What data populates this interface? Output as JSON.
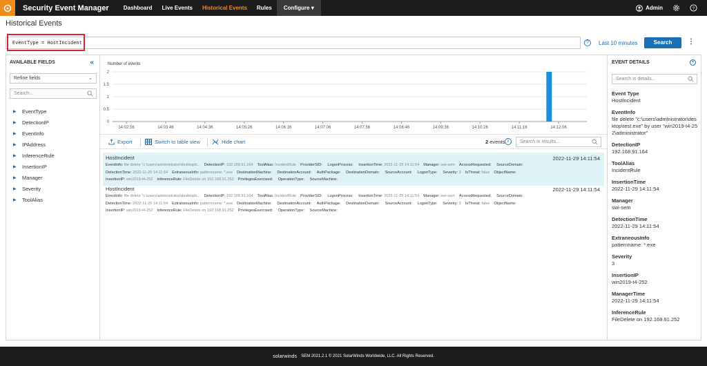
{
  "app": {
    "title": "Security Event Manager",
    "nav": [
      "Dashboard",
      "Live Events",
      "Historical Events",
      "Rules"
    ],
    "configure": "Configure ▾",
    "user": "Admin"
  },
  "page": {
    "title": "Historical Events",
    "query": "EventType = HostIncident",
    "time_range": "Last 10 minutes",
    "search_button": "Search"
  },
  "left_panel": {
    "header": "AVAILABLE FIELDS",
    "refine": "Refine fields",
    "search_placeholder": "Search...",
    "fields": [
      "EventType",
      "DetectionIP",
      "EventInfo",
      "IPAddress",
      "InferenceRule",
      "InsertionIP",
      "Manager",
      "Severity",
      "ToolAlias"
    ]
  },
  "chart_data": {
    "type": "bar",
    "ylabel": "Number of events",
    "ylim": [
      0,
      2
    ],
    "yticks": [
      "0",
      "0.5",
      "1",
      "1.5",
      "2"
    ],
    "x_ticks": [
      "14:02:56",
      "14:03:46",
      "14:04:36",
      "14:05:26",
      "14:06:16",
      "14:07:06",
      "14:07:56",
      "14:08:46",
      "14:09:36",
      "14:10:26",
      "14:11:16",
      "14:12:06"
    ],
    "bars": [
      {
        "x": "14:11:54",
        "value": 2
      }
    ],
    "bar_color": "#1a8fe0"
  },
  "toolbar": {
    "export": "Export",
    "table_view": "Switch to table view",
    "hide_chart": "Hide chart",
    "count_num": "2",
    "count_label": "events",
    "results_placeholder": "Search in results..."
  },
  "events": [
    {
      "title": "HostIncident",
      "time": "2022-11-29 14:11:54",
      "line1": [
        [
          "EventInfo:",
          "file delete \"c:\\users\\administrator\\desktop\\t..."
        ],
        [
          "DetectionIP:",
          "192.168.91.164"
        ],
        [
          "ToolAlias:",
          "IncidentRule"
        ],
        [
          "ProviderSID:",
          ""
        ],
        [
          "LogonProcess:",
          ""
        ],
        [
          "InsertionTime:",
          "2022-11-29 14:11:54"
        ],
        [
          "Manager:",
          "swi-sem"
        ],
        [
          "AccessRequested:",
          ""
        ],
        [
          "SourceDomain:",
          ""
        ]
      ],
      "line2": [
        [
          "DetectionTime:",
          "2022-11-29 14:11:54"
        ],
        [
          "ExtraneousInfo:",
          "patternname: *.exe"
        ],
        [
          "DestinationMachine:",
          ""
        ],
        [
          "DestinationAccount:",
          ""
        ],
        [
          "AuthPackage:",
          ""
        ],
        [
          "DestinationDomain:",
          ""
        ],
        [
          "SourceAccount:",
          ""
        ],
        [
          "LogonType:",
          ""
        ],
        [
          "Severity:",
          "3"
        ],
        [
          "IsThreat:",
          "false"
        ],
        [
          "ObjectName:",
          ""
        ]
      ],
      "line3": [
        [
          "InsertionIP:",
          "win2019-t4-252"
        ],
        [
          "InferenceRule:",
          "FileDelete on 192.168.91.252"
        ],
        [
          "PrivilegesExercised:",
          ""
        ],
        [
          "OperationType:",
          ""
        ],
        [
          "SourceMachine:",
          ""
        ]
      ]
    },
    {
      "title": "HostIncident",
      "time": "2022-11-29 14:11:54",
      "line1": [
        [
          "EventInfo:",
          "file delete \"c:\\users\\administrator\\desktop\\t..."
        ],
        [
          "DetectionIP:",
          "192.168.91.164"
        ],
        [
          "ToolAlias:",
          "IncidentRule"
        ],
        [
          "ProviderSID:",
          ""
        ],
        [
          "LogonProcess:",
          ""
        ],
        [
          "InsertionTime:",
          "2022-11-29 14:11:54"
        ],
        [
          "Manager:",
          "swi-sem"
        ],
        [
          "AccessRequested:",
          ""
        ],
        [
          "SourceDomain:",
          ""
        ]
      ],
      "line2": [
        [
          "DetectionTime:",
          "2022-11-29 14:11:54"
        ],
        [
          "ExtraneousInfo:",
          "patternname: *.exe"
        ],
        [
          "DestinationMachine:",
          ""
        ],
        [
          "DestinationAccount:",
          ""
        ],
        [
          "AuthPackage:",
          ""
        ],
        [
          "DestinationDomain:",
          ""
        ],
        [
          "SourceAccount:",
          ""
        ],
        [
          "LogonType:",
          ""
        ],
        [
          "Severity:",
          "3"
        ],
        [
          "IsThreat:",
          "false"
        ],
        [
          "ObjectName:",
          ""
        ]
      ],
      "line3": [
        [
          "InsertionIP:",
          "win2019-t4-252"
        ],
        [
          "InferenceRule:",
          "FileDelete on 192.168.91.252"
        ],
        [
          "PrivilegesExercised:",
          ""
        ],
        [
          "OperationType:",
          ""
        ],
        [
          "SourceMachine:",
          ""
        ]
      ]
    }
  ],
  "details_panel": {
    "header": "EVENT DETAILS",
    "search_placeholder": "Search in details...",
    "items": [
      {
        "label": "Event Type",
        "value": "HostIncident"
      },
      {
        "label": "EventInfo",
        "value": "file delete \"c:\\users\\administrator\\desktop\\test.exe\" by user \"win2019-t4-252\\administrator\""
      },
      {
        "label": "DetectionIP",
        "value": "192.168.91.164"
      },
      {
        "label": "ToolAlias",
        "value": "IncidentRule"
      },
      {
        "label": "InsertionTime",
        "value": "2022-11-29 14:11:54"
      },
      {
        "label": "Manager",
        "value": "swi-sem"
      },
      {
        "label": "DetectionTime",
        "value": "2022-11-29 14:11:54"
      },
      {
        "label": "ExtraneousInfo",
        "value": "patternname: *.exe"
      },
      {
        "label": "Severity",
        "value": "3"
      },
      {
        "label": "InsertionIP",
        "value": "win2019-t4-252"
      },
      {
        "label": "ManagerTime",
        "value": "2022-11-29 14:11:54"
      },
      {
        "label": "InferenceRule",
        "value": "FileDelete on 192.168.91.252"
      }
    ]
  },
  "footer": {
    "brand": "solarwinds",
    "text": "SEM 2021.2.1 © 2021 SolarWinds Worldwide, LLC. All Rights Reserved."
  },
  "colors": {
    "accent": "#1a6fb5",
    "nav_active": "#f28c28",
    "highlight": "#d9232d",
    "selected_row": "#dff2f5"
  }
}
